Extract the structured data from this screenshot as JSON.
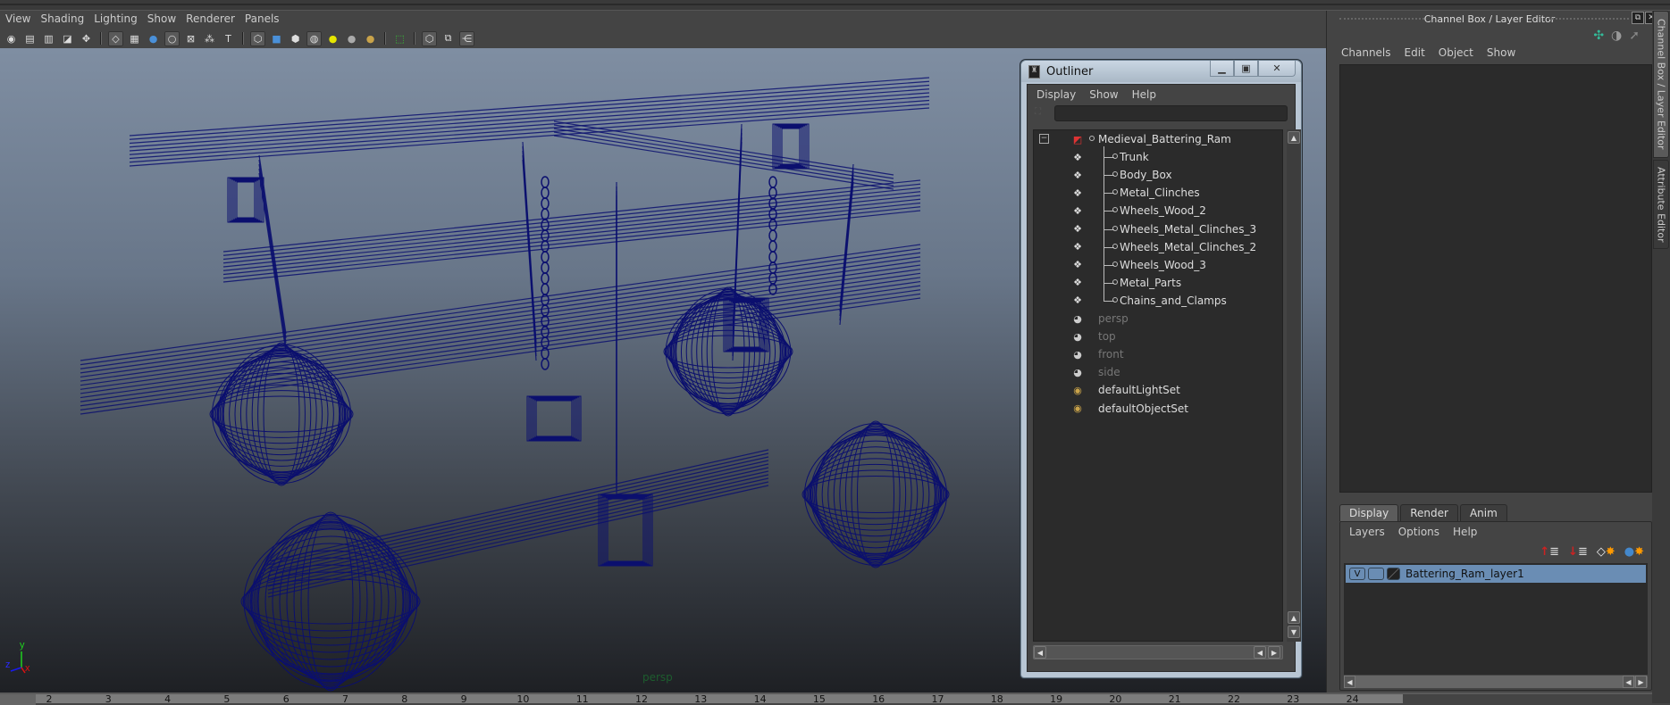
{
  "viewport": {
    "menu": [
      "View",
      "Shading",
      "Lighting",
      "Show",
      "Renderer",
      "Panels"
    ],
    "toolbar_icons": [
      {
        "name": "select-camera-icon",
        "glyph": "◉"
      },
      {
        "name": "camera-attributes-icon",
        "glyph": "▤"
      },
      {
        "name": "bookmark-icon",
        "glyph": "▥"
      },
      {
        "name": "image-plane-icon",
        "glyph": "◪"
      },
      {
        "name": "pan-zoom-icon",
        "glyph": "✥"
      },
      {
        "name": "grid-icon",
        "glyph": "◇",
        "on": true
      },
      {
        "name": "film-gate-icon",
        "glyph": "▦"
      },
      {
        "name": "resolution-gate-icon",
        "glyph": "●"
      },
      {
        "name": "gate-mask-icon",
        "glyph": "○",
        "on": true
      },
      {
        "name": "field-chart-icon",
        "glyph": "⊠"
      },
      {
        "name": "safe-action-icon",
        "glyph": "⁂"
      },
      {
        "name": "safe-title-icon",
        "glyph": "T"
      },
      {
        "name": "wireframe-icon",
        "glyph": "⬡",
        "on": true
      },
      {
        "name": "smooth-shade-icon",
        "glyph": "■"
      },
      {
        "name": "wireframe-on-shaded-icon",
        "glyph": "⬢"
      },
      {
        "name": "textured-icon",
        "glyph": "◍",
        "on": true
      },
      {
        "name": "use-all-lights-icon",
        "glyph": "●"
      },
      {
        "name": "shadows-icon",
        "glyph": "●"
      },
      {
        "name": "high-quality-icon",
        "glyph": "●"
      },
      {
        "name": "xray-select-icon",
        "glyph": "⬚"
      },
      {
        "name": "isolate-select-icon",
        "glyph": "⬡",
        "on": true
      },
      {
        "name": "xray-icon",
        "glyph": "⧉"
      },
      {
        "name": "xray-joints-icon",
        "glyph": "⋲",
        "on": true
      }
    ],
    "camera_label": "persp",
    "axis_labels": {
      "x": "x",
      "y": "y",
      "z": "z"
    }
  },
  "timeline": {
    "frames": [
      "2",
      "3",
      "4",
      "5",
      "6",
      "7",
      "8",
      "9",
      "10",
      "11",
      "12",
      "13",
      "14",
      "15",
      "16",
      "17",
      "18",
      "19",
      "20",
      "21",
      "22",
      "23",
      "24"
    ]
  },
  "outliner": {
    "title": "Outliner",
    "menu": [
      "Display",
      "Show",
      "Help"
    ],
    "filter_value": "",
    "items": [
      {
        "label": "Medieval_Battering_Ram",
        "type": "group",
        "level": 0,
        "dim": false
      },
      {
        "label": "Trunk",
        "type": "mesh",
        "level": 1,
        "dim": false
      },
      {
        "label": "Body_Box",
        "type": "mesh",
        "level": 1,
        "dim": false
      },
      {
        "label": "Metal_Clinches",
        "type": "mesh",
        "level": 1,
        "dim": false
      },
      {
        "label": "Wheels_Wood_2",
        "type": "mesh",
        "level": 1,
        "dim": false
      },
      {
        "label": "Wheels_Metal_Clinches_3",
        "type": "mesh",
        "level": 1,
        "dim": false
      },
      {
        "label": "Wheels_Metal_Clinches_2",
        "type": "mesh",
        "level": 1,
        "dim": false
      },
      {
        "label": "Wheels_Wood_3",
        "type": "mesh",
        "level": 1,
        "dim": false
      },
      {
        "label": "Metal_Parts",
        "type": "mesh",
        "level": 1,
        "dim": false
      },
      {
        "label": "Chains_and_Clamps",
        "type": "mesh",
        "level": 1,
        "dim": false
      },
      {
        "label": "persp",
        "type": "camera",
        "level": 0,
        "dim": true
      },
      {
        "label": "top",
        "type": "camera",
        "level": 0,
        "dim": true
      },
      {
        "label": "front",
        "type": "camera",
        "level": 0,
        "dim": true
      },
      {
        "label": "side",
        "type": "camera",
        "level": 0,
        "dim": true
      },
      {
        "label": "defaultLightSet",
        "type": "set",
        "level": 0,
        "dim": false
      },
      {
        "label": "defaultObjectSet",
        "type": "set",
        "level": 0,
        "dim": false
      }
    ]
  },
  "channel_box": {
    "title": "Channel Box / Layer Editor",
    "menu": [
      "Channels",
      "Edit",
      "Object",
      "Show"
    ],
    "tabs": [
      {
        "label": "Display",
        "active": true
      },
      {
        "label": "Render",
        "active": false
      },
      {
        "label": "Anim",
        "active": false
      }
    ],
    "layer_menu": [
      "Layers",
      "Options",
      "Help"
    ],
    "layers": [
      {
        "visible": "V",
        "name": "Battering_Ram_layer1"
      }
    ],
    "layer_color": "#6a8db4"
  },
  "side_tabs": [
    "Channel Box / Layer Editor",
    "Attribute Editor"
  ],
  "colors": {
    "wireframe": "#0b0f6e",
    "selection": "#6a8db4"
  }
}
